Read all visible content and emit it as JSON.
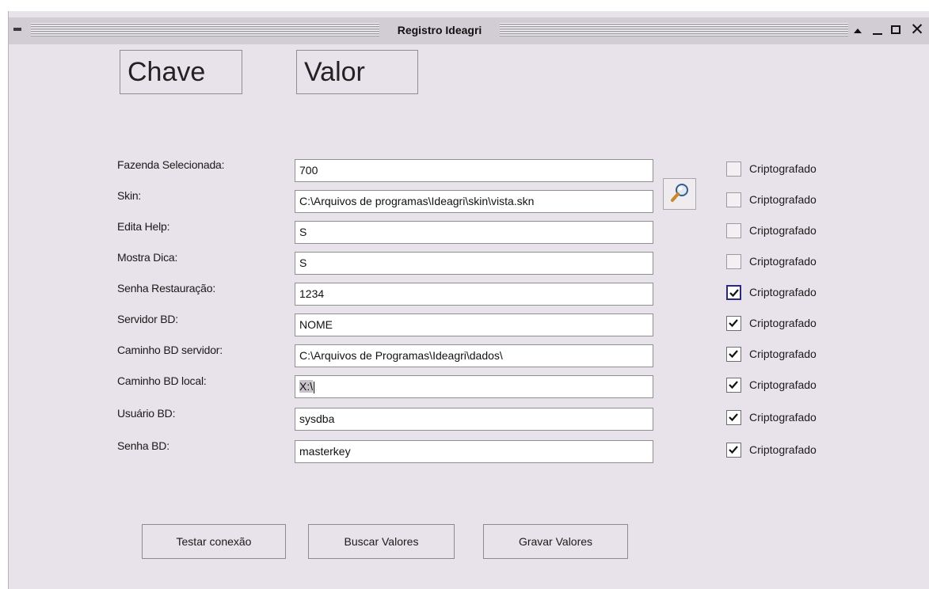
{
  "window": {
    "title": "Registro Ideagri",
    "close_glyph": "✕"
  },
  "headers": {
    "key": "Chave",
    "value": "Valor"
  },
  "rows": [
    {
      "label": "Fazenda Selecionada:",
      "value": "700",
      "checkbox_label": "Criptografado",
      "checked": false
    },
    {
      "label": "Skin:",
      "value": "C:\\Arquivos de programas\\Ideagri\\skin\\vista.skn",
      "checkbox_label": "Criptografado",
      "checked": false
    },
    {
      "label": "Edita Help:",
      "value": "S",
      "checkbox_label": "Criptografado",
      "checked": false
    },
    {
      "label": "Mostra Dica:",
      "value": "S",
      "checkbox_label": "Criptografado",
      "checked": false
    },
    {
      "label": "Senha Restauração:",
      "value": "1234",
      "checkbox_label": "Criptografado",
      "checked": true
    },
    {
      "label": "Servidor BD:",
      "value": "NOME",
      "checkbox_label": "Criptografado",
      "checked": true
    },
    {
      "label": "Caminho BD servidor:",
      "value": "C:\\Arquivos de Programas\\Ideagri\\dados\\",
      "checkbox_label": "Criptografado",
      "checked": true
    },
    {
      "label": "Caminho BD local:",
      "value": "X:\\",
      "checkbox_label": "Criptografado",
      "checked": true
    },
    {
      "label": "Usuário BD:",
      "value": "sysdba",
      "checkbox_label": "Criptografado",
      "checked": true
    },
    {
      "label": "Senha BD:",
      "value": "masterkey",
      "checkbox_label": "Criptografado",
      "checked": true
    }
  ],
  "buttons": {
    "test": "Testar conexão",
    "fetch": "Buscar Valores",
    "save": "Gravar Valores"
  },
  "icons": {
    "browse": "magnifier-icon"
  },
  "colors": {
    "window_bg": "#e8e2ea",
    "titlebar_bg": "#d2cdd5",
    "field_bg": "#ffffff",
    "focus_border": "#2a2a7a"
  }
}
